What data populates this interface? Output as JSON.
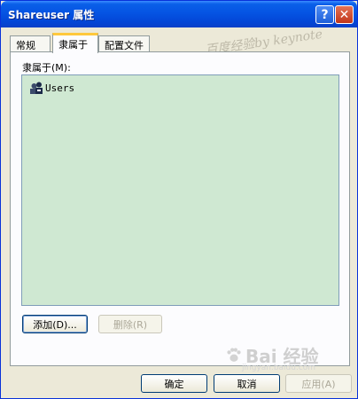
{
  "window": {
    "title": "Shareuser 属性",
    "help_glyph": "?",
    "close_glyph": "✕"
  },
  "tabs": [
    {
      "label": "常规"
    },
    {
      "label": "隶属于"
    },
    {
      "label": "配置文件"
    }
  ],
  "member_of": {
    "label": "隶属于(M):",
    "items": [
      {
        "name": "Users",
        "icon": "group-icon"
      }
    ]
  },
  "buttons": {
    "add": "添加(D)...",
    "remove": "删除(R)",
    "ok": "确定",
    "cancel": "取消",
    "apply": "应用(A)"
  },
  "watermarks": {
    "top": "百度经验by keynote",
    "brand": "Bai 经验",
    "url": "jingyan.baidu.com"
  },
  "colors": {
    "titlebar": "#0554e3",
    "listbox_bg": "#cfe8d2",
    "active_tab_accent": "#ffc83c",
    "close_button": "#c1361a"
  }
}
